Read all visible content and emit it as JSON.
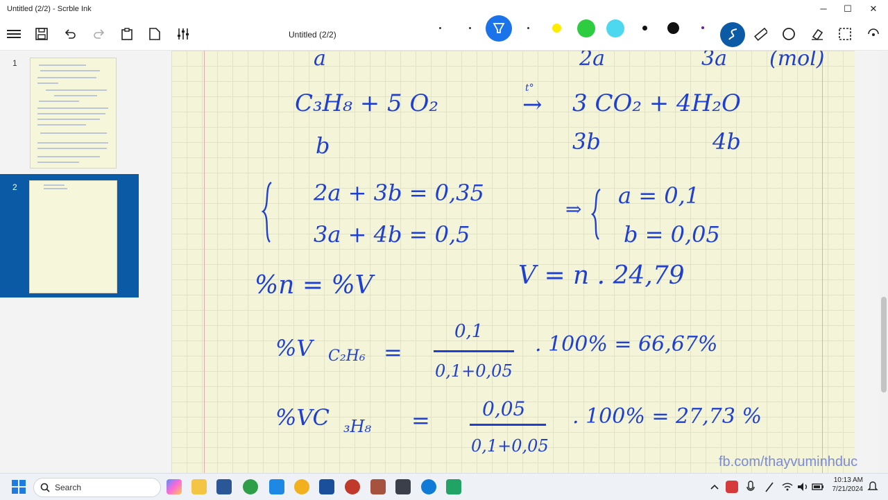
{
  "window": {
    "title": "Untitled (2/2) - Scrble Ink",
    "min": "─",
    "max": "☐",
    "close": "✕"
  },
  "toolbar": {
    "doc_title": "Untitled (2/2)"
  },
  "pens": {
    "colors": [
      "#1a73e8",
      "#ffeb00",
      "#2ecc40",
      "#4dd8f0",
      "#111111",
      "#111111",
      "#6a1b9a"
    ]
  },
  "sidebar": {
    "pages": [
      {
        "number": "1"
      },
      {
        "number": "2"
      }
    ]
  },
  "note": {
    "r1_a": "a",
    "r1_2a": "2a",
    "r1_3a": "3a",
    "r1_mol": "(mol)",
    "eq_lhs": "C₃H₈ + 5 O₂",
    "eq_arrow": "→",
    "eq_temp": "t°",
    "eq_rhs": "3 CO₂ + 4H₂O",
    "r3_b": "b",
    "r3_3b": "3b",
    "r3_4b": "4b",
    "sys1": "2a + 3b = 0,35",
    "sys2": "3a + 4b = 0,5",
    "implies": "⇒",
    "sol1": "a = 0,1",
    "sol2": "b = 0,05",
    "pct_line": "%n = %V",
    "v_line": "V = n . 24,79",
    "v1_label": "%V",
    "v1_sub": "C₂H₆",
    "v1_eq": "=",
    "v1_num": "0,1",
    "v1_den": "0,1+0,05",
    "v1_rest": ". 100% = 66,67%",
    "v2_label": "%VC",
    "v2_sub": "₃H₈",
    "v2_eq": "=",
    "v2_num": "0,05",
    "v2_den": "0,1+0,05",
    "v2_rest": ". 100% = 27,73 %"
  },
  "watermark": "fb.com/thayvuminhduc",
  "taskbar": {
    "search_placeholder": "Search",
    "time": "10:13 AM",
    "date": "7/21/2024"
  }
}
